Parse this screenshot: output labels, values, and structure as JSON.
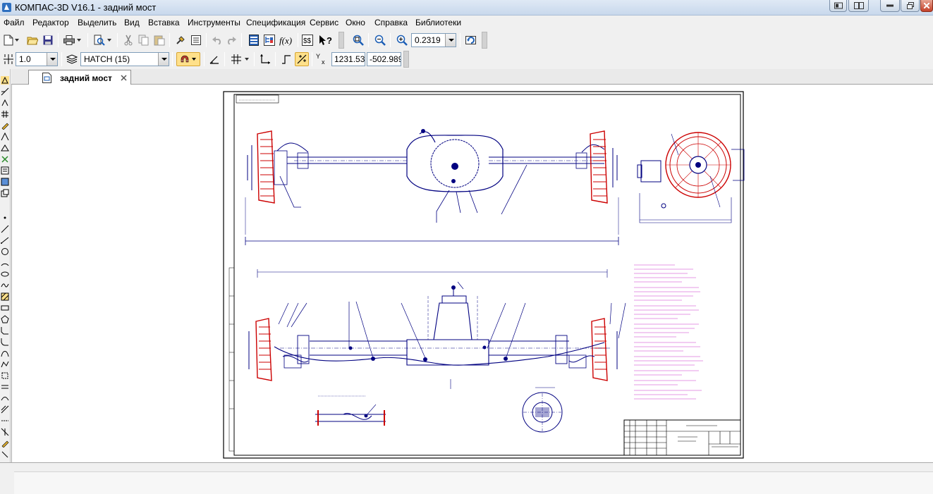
{
  "window": {
    "title": "КОМПАС-3D V16.1 - задний мост",
    "accent_color": "#c8d8ec"
  },
  "menu": {
    "items": [
      "Файл",
      "Редактор",
      "Выделить",
      "Вид",
      "Вставка",
      "Инструменты",
      "Спецификация",
      "Сервис",
      "Окно",
      "Справка",
      "Библиотеки"
    ]
  },
  "toolbar_standard": {
    "buttons": [
      "new-document-icon",
      "open-icon",
      "save-icon",
      "print-icon",
      "print-preview-icon",
      "cut-icon",
      "copy-icon",
      "paste-icon",
      "format-painter-icon",
      "properties-icon",
      "undo-icon",
      "redo-icon",
      "manager-icon",
      "tree-icon",
      "variables-icon",
      "library-icon",
      "help-icon",
      "zoom-window-icon",
      "zoom-icon",
      "zoom-in-icon",
      "refresh-icon"
    ],
    "zoom_value": "0.2319"
  },
  "toolbar_current_state": {
    "step_value": "1.0",
    "layer_value": "HATCH (15)",
    "coord_x_label": "Y",
    "coord_x": "1231.53",
    "coord_y": "-502.989"
  },
  "tabs": [
    {
      "label": "задний мост",
      "active": true
    }
  ],
  "drawing": {
    "sheet_color": "#ffffff",
    "line_color": "#000080",
    "highlight_color": "#cc0000",
    "note_color": "#cc33cc"
  }
}
